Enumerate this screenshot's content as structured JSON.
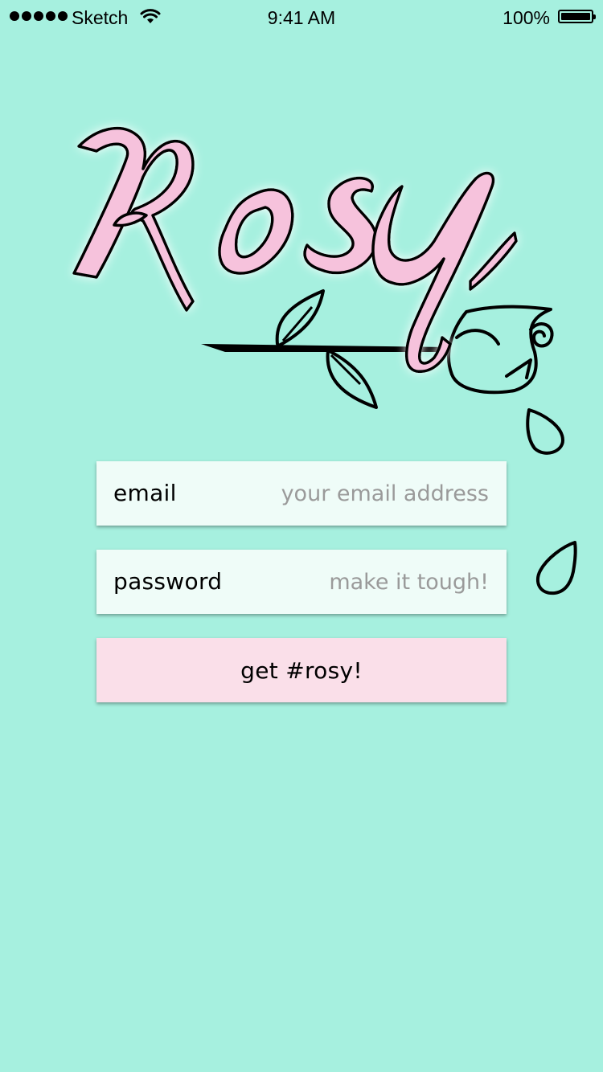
{
  "status_bar": {
    "carrier": "Sketch",
    "time": "9:41 AM",
    "battery": "100%"
  },
  "logo": {
    "text": "Rosy",
    "fill_color": "#f6c2dc",
    "outline_color": "#000000"
  },
  "form": {
    "email": {
      "label": "email",
      "placeholder": "your email address",
      "value": ""
    },
    "password": {
      "label": "password",
      "placeholder": "make it tough!",
      "value": ""
    },
    "submit_label": "get #rosy!"
  },
  "colors": {
    "background": "#a6f0df",
    "field_background": "#effcf8",
    "button_background": "#fadfe9"
  }
}
